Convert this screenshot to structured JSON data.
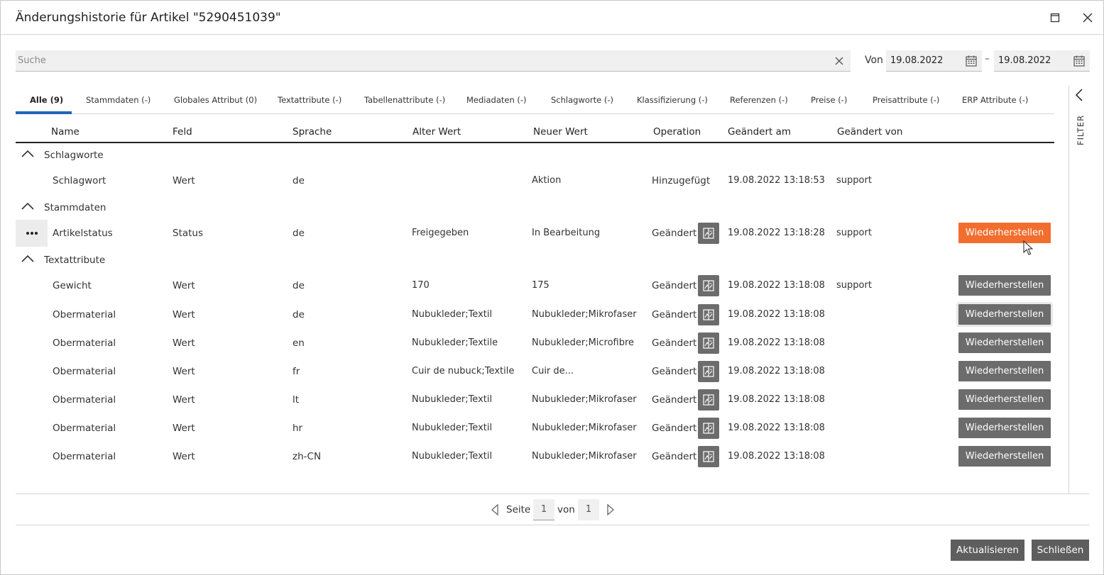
{
  "dialog": {
    "title": "Änderungshistorie für Artikel \"5290451039\"",
    "maximize_icon": "maximize-icon",
    "close_icon": "close-icon"
  },
  "search": {
    "placeholder": "Suche",
    "value": ""
  },
  "date_range": {
    "from_label": "Von",
    "from": "19.08.2022",
    "separator": "–",
    "to": "19.08.2022"
  },
  "tabs": [
    {
      "label": "Alle (9)",
      "active": true
    },
    {
      "label": "Stammdaten (-)"
    },
    {
      "label": "Globales Attribut (0)"
    },
    {
      "label": "Textattribute (-)"
    },
    {
      "label": "Tabellenattribute (-)"
    },
    {
      "label": "Mediadaten (-)"
    },
    {
      "label": "Schlagworte (-)"
    },
    {
      "label": "Klassifizierung (-)"
    },
    {
      "label": "Referenzen (-)"
    },
    {
      "label": "Preise (-)"
    },
    {
      "label": "Preisattribute (-)"
    },
    {
      "label": "ERP Attribute (-)"
    }
  ],
  "filter": {
    "label": "FILTER"
  },
  "table": {
    "columns": [
      "Name",
      "Feld",
      "Sprache",
      "Alter Wert",
      "Neuer Wert",
      "Operation",
      "Geändert am",
      "Geändert von"
    ],
    "groups": [
      {
        "label": "Schlagworte",
        "rows": [
          {
            "name": "Schlagwort",
            "field": "Wert",
            "lang": "de",
            "old": "",
            "new": "Aktion",
            "op": "Hinzugefügt",
            "date": "19.08.2022 13:18:53",
            "user": "support"
          }
        ]
      },
      {
        "label": "Stammdaten",
        "rows": [
          {
            "name": "Artikelstatus",
            "field": "Status",
            "lang": "de",
            "old": "Freigegeben",
            "new": "In Bearbeitung",
            "op": "Geändert",
            "date": "19.08.2022 13:18:28",
            "user": "support",
            "restore": "Wiederherstellen"
          }
        ]
      },
      {
        "label": "Textattribute",
        "rows": [
          {
            "name": "Gewicht",
            "field": "Wert",
            "lang": "de",
            "old": "170",
            "new": "175",
            "op": "Geändert",
            "date": "19.08.2022 13:18:08",
            "user": "support",
            "restore": "Wiederherstellen"
          },
          {
            "name": "Obermaterial",
            "field": "Wert",
            "lang": "de",
            "old": "Nubukleder;Textil",
            "new": "Nubukleder;Mikrofaser",
            "op": "Geändert",
            "date": "19.08.2022 13:18:08",
            "user": "",
            "restore": "Wiederherstellen"
          },
          {
            "name": "Obermaterial",
            "field": "Wert",
            "lang": "en",
            "old": "Nubukleder;Textile",
            "new": "Nubukleder;Microfibre",
            "op": "Geändert",
            "date": "19.08.2022 13:18:08",
            "user": "",
            "restore": "Wiederherstellen"
          },
          {
            "name": "Obermaterial",
            "field": "Wert",
            "lang": "fr",
            "old": "Cuir de nubuck;Textile",
            "new": "Cuir de...",
            "op": "Geändert",
            "date": "19.08.2022 13:18:08",
            "user": "",
            "restore": "Wiederherstellen"
          },
          {
            "name": "Obermaterial",
            "field": "Wert",
            "lang": "lt",
            "old": "Nubukleder;Textil",
            "new": "Nubukleder;Mikrofaser",
            "op": "Geändert",
            "date": "19.08.2022 13:18:08",
            "user": "",
            "restore": "Wiederherstellen"
          },
          {
            "name": "Obermaterial",
            "field": "Wert",
            "lang": "hr",
            "old": "Nubukleder;Textil",
            "new": "Nubukleder;Mikrofaser",
            "op": "Geändert",
            "date": "19.08.2022 13:18:08",
            "user": "",
            "restore": "Wiederherstellen"
          },
          {
            "name": "Obermaterial",
            "field": "Wert",
            "lang": "zh-CN",
            "old": "Nubukleder;Textil",
            "new": "Nubukleder;Mikrofaser",
            "op": "Geändert",
            "date": "19.08.2022 13:18:08",
            "user": "",
            "restore": "Wiederherstellen"
          }
        ]
      }
    ]
  },
  "pager": {
    "page_label": "Seite",
    "current": "1",
    "of_label": "von",
    "total": "1"
  },
  "footer": {
    "refresh": "Aktualisieren",
    "close": "Schließen"
  },
  "colors": {
    "accent_tab": "#1f66b5",
    "restore_active": "#f26e2e",
    "button_gray": "#6c6c6c"
  }
}
